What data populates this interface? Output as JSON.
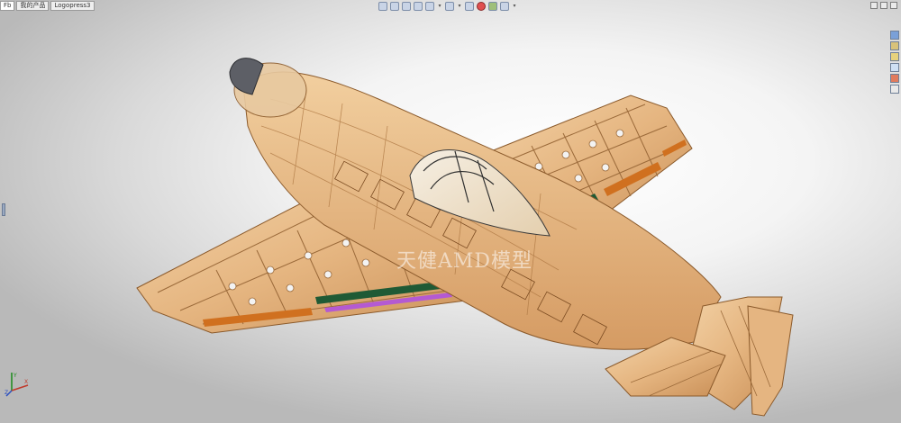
{
  "tabs": [
    {
      "label": "Fb"
    },
    {
      "label": "我的产品"
    },
    {
      "label": "Logopress3"
    }
  ],
  "toolbar": {
    "icons": [
      "zoom-to-fit-icon",
      "zoom-area-icon",
      "previous-view-icon",
      "section-view-icon",
      "view-orientation-icon",
      "display-style-icon",
      "hide-show-icon",
      "edit-appearance-icon",
      "apply-scene-icon",
      "view-settings-icon"
    ]
  },
  "window_controls": [
    "minimize-icon",
    "restore-icon",
    "close-icon"
  ],
  "task_pane": {
    "icons": [
      "solidworks-resources-icon",
      "design-library-icon",
      "file-explorer-icon",
      "view-palette-icon",
      "appearances-icon",
      "custom-properties-icon"
    ]
  },
  "watermark": "天健AMD模型",
  "colors": {
    "wood": "#e7b886",
    "wood_dark": "#b9824e",
    "green": "#1f5a35",
    "orange": "#d0701f",
    "purple": "#b45ad2",
    "spinner": "#5d5f66"
  }
}
